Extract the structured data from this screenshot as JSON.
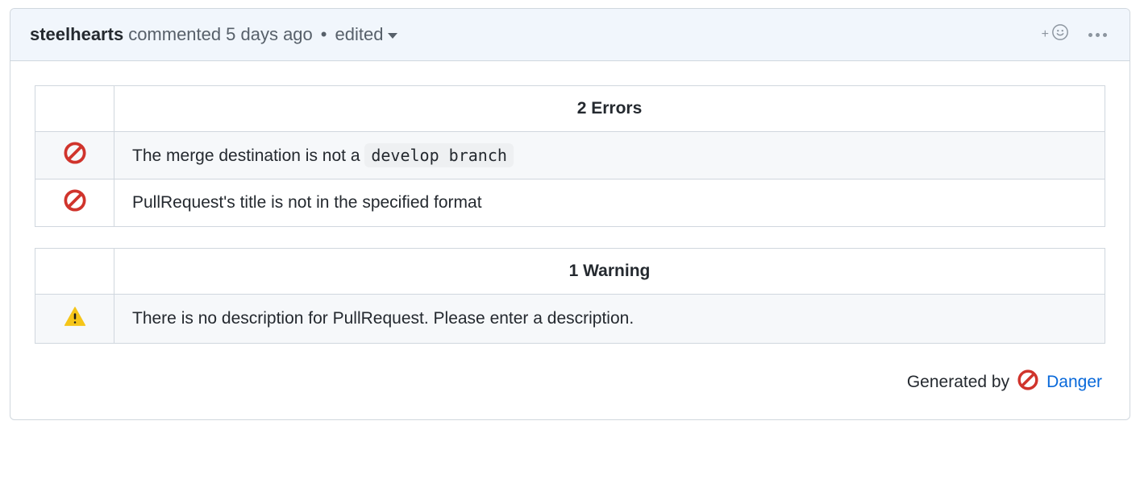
{
  "header": {
    "author": "steelhearts",
    "action": "commented",
    "relative_time": "5 days ago",
    "edited_label": "edited"
  },
  "errors": {
    "heading": "2 Errors",
    "items": [
      {
        "text_before": "The merge destination is not a ",
        "code": "develop branch",
        "text_after": ""
      },
      {
        "text_before": "PullRequest's title is not in the specified format",
        "code": "",
        "text_after": ""
      }
    ]
  },
  "warnings": {
    "heading": "1 Warning",
    "items": [
      {
        "text": "There is no description for PullRequest. Please enter a description."
      }
    ]
  },
  "footer": {
    "generated_by": "Generated by",
    "link_text": "Danger"
  }
}
